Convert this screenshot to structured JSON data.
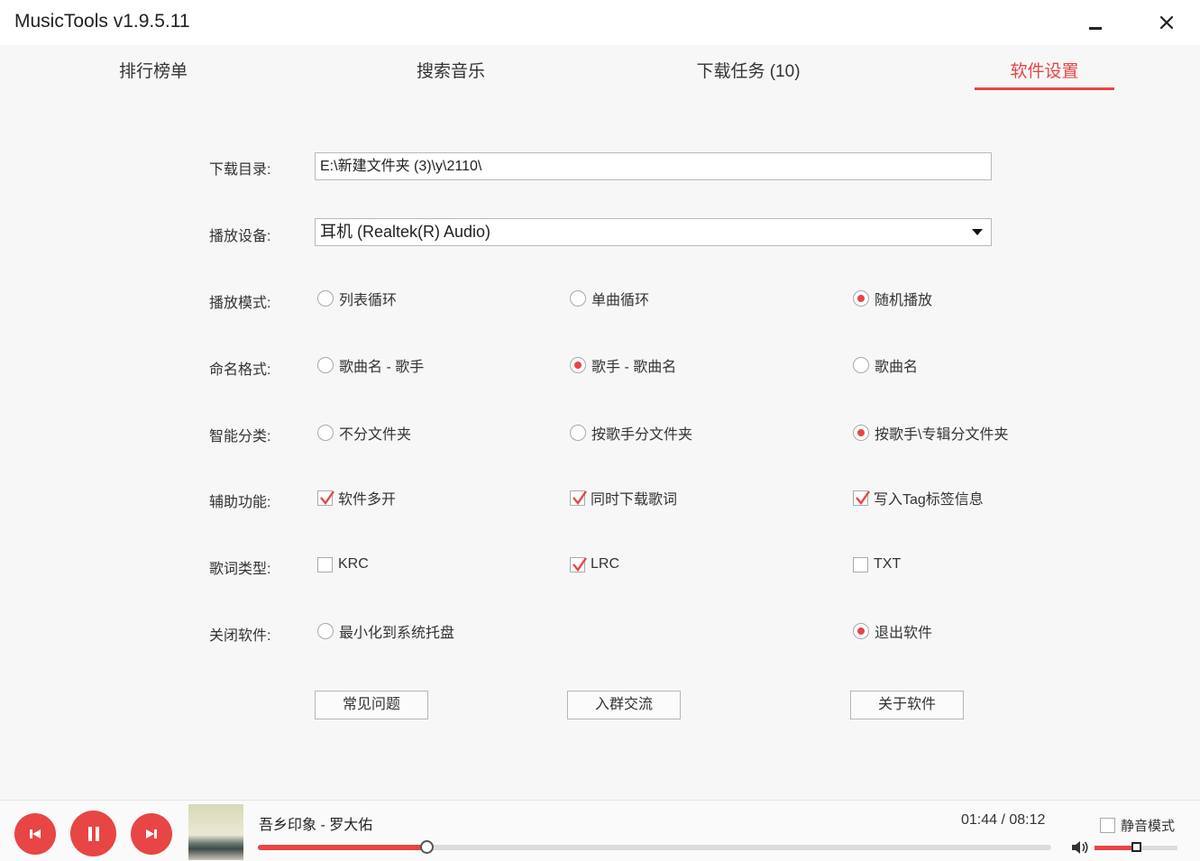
{
  "window": {
    "title": "MusicTools v1.9.5.11",
    "minimize_icon": "minimize-icon",
    "close_icon": "close-icon"
  },
  "tabs": [
    {
      "label": "排行榜单",
      "active": false
    },
    {
      "label": "搜索音乐",
      "active": false
    },
    {
      "label": "下载任务 (10)",
      "active": false
    },
    {
      "label": "软件设置",
      "active": true
    }
  ],
  "accent_color": "#e84545",
  "settings": {
    "download_dir": {
      "label": "下载目录:",
      "value": "E:\\新建文件夹 (3)\\y\\2110\\"
    },
    "play_device": {
      "label": "播放设备:",
      "value": "耳机 (Realtek(R) Audio)"
    },
    "play_mode": {
      "label": "播放模式:",
      "options": [
        "列表循环",
        "单曲循环",
        "随机播放"
      ],
      "selected": 2
    },
    "naming_format": {
      "label": "命名格式:",
      "options": [
        "歌曲名 - 歌手",
        "歌手 - 歌曲名",
        "歌曲名"
      ],
      "selected": 1
    },
    "smart_sort": {
      "label": "智能分类:",
      "options": [
        "不分文件夹",
        "按歌手分文件夹",
        "按歌手\\专辑分文件夹"
      ],
      "selected": 2
    },
    "aux_functions": {
      "label": "辅助功能:",
      "options": [
        {
          "label": "软件多开",
          "checked": true
        },
        {
          "label": "同时下载歌词",
          "checked": true
        },
        {
          "label": "写入Tag标签信息",
          "checked": true
        }
      ]
    },
    "lyrics_type": {
      "label": "歌词类型:",
      "options": [
        {
          "label": "KRC",
          "checked": false
        },
        {
          "label": "LRC",
          "checked": true
        },
        {
          "label": "TXT",
          "checked": false
        }
      ]
    },
    "close_behavior": {
      "label": "关闭软件:",
      "options": [
        "最小化到系统托盘",
        "退出软件"
      ],
      "selected": 1
    },
    "buttons": [
      "常见问题",
      "入群交流",
      "关于软件"
    ]
  },
  "player": {
    "song": "吾乡印象 - 罗大佑",
    "time": "01:44 / 08:12",
    "progress": 0.212,
    "mute_label": "静音模式",
    "mute_checked": false,
    "volume": 0.5,
    "icons": [
      "previous-icon",
      "pause-icon",
      "next-icon",
      "volume-icon"
    ]
  }
}
